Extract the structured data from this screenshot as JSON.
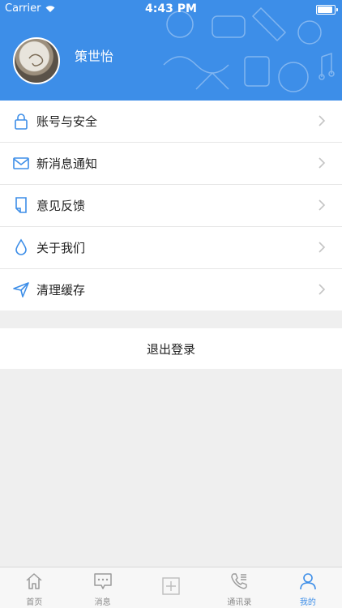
{
  "colors": {
    "accent": "#3d8ee8",
    "background": "#efefef",
    "card": "#ffffff"
  },
  "status_bar": {
    "carrier": "Carrier",
    "time": "4:43 PM",
    "battery_level": 0.9
  },
  "profile": {
    "name": "策世怡"
  },
  "menu": [
    {
      "label": "账号与安全",
      "icon": "lock-icon"
    },
    {
      "label": "新消息通知",
      "icon": "mail-icon"
    },
    {
      "label": "意见反馈",
      "icon": "document-icon"
    },
    {
      "label": "关于我们",
      "icon": "water-drop-icon"
    },
    {
      "label": "清理缓存",
      "icon": "paper-plane-icon"
    }
  ],
  "logout": {
    "label": "退出登录"
  },
  "tabbar": [
    {
      "label": "首页",
      "icon": "home-icon",
      "active": false
    },
    {
      "label": "消息",
      "icon": "message-icon",
      "active": false
    },
    {
      "label": "",
      "icon": "add-icon",
      "active": false
    },
    {
      "label": "通讯录",
      "icon": "phone-contacts-icon",
      "active": false
    },
    {
      "label": "我的",
      "icon": "person-icon",
      "active": true
    }
  ]
}
